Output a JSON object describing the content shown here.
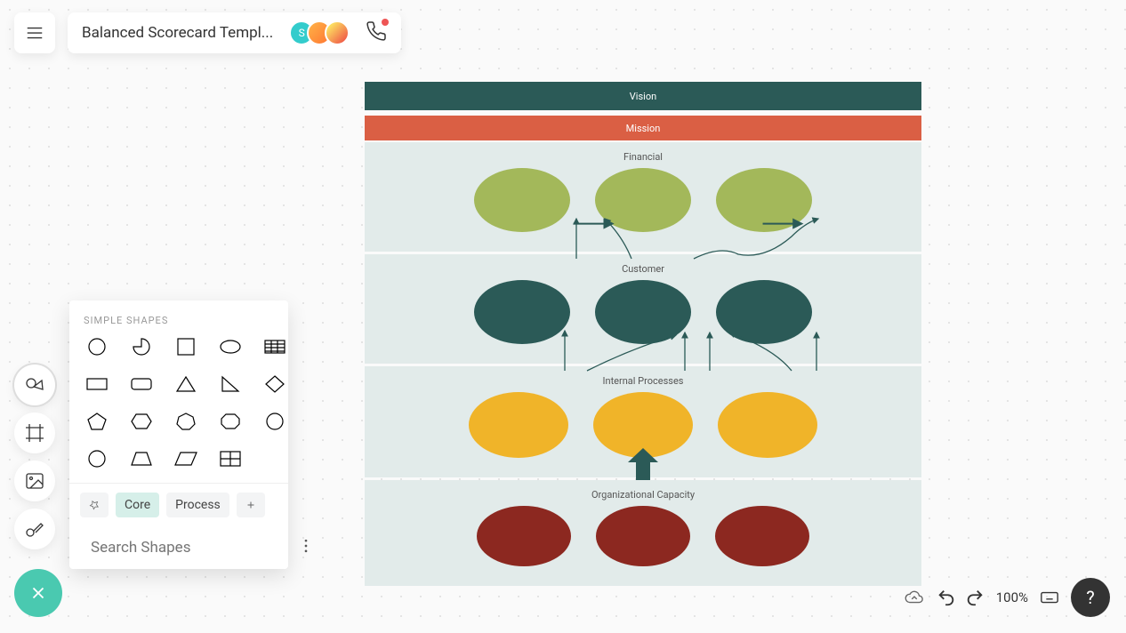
{
  "header": {
    "title": "Balanced Scorecard Templ...",
    "avatars": [
      {
        "initial": "S"
      },
      {
        "initial": ""
      },
      {
        "initial": ""
      }
    ]
  },
  "shapes_panel": {
    "section_label": "SIMPLE SHAPES",
    "tabs": {
      "core": "Core",
      "process": "Process"
    },
    "search_placeholder": "Search Shapes"
  },
  "diagram": {
    "vision": "Vision",
    "mission": "Mission",
    "sections": [
      {
        "title": "Financial"
      },
      {
        "title": "Customer"
      },
      {
        "title": "Internal Processes"
      },
      {
        "title": "Organizational Capacity"
      }
    ]
  },
  "bottom": {
    "zoom": "100%",
    "help": "?"
  }
}
